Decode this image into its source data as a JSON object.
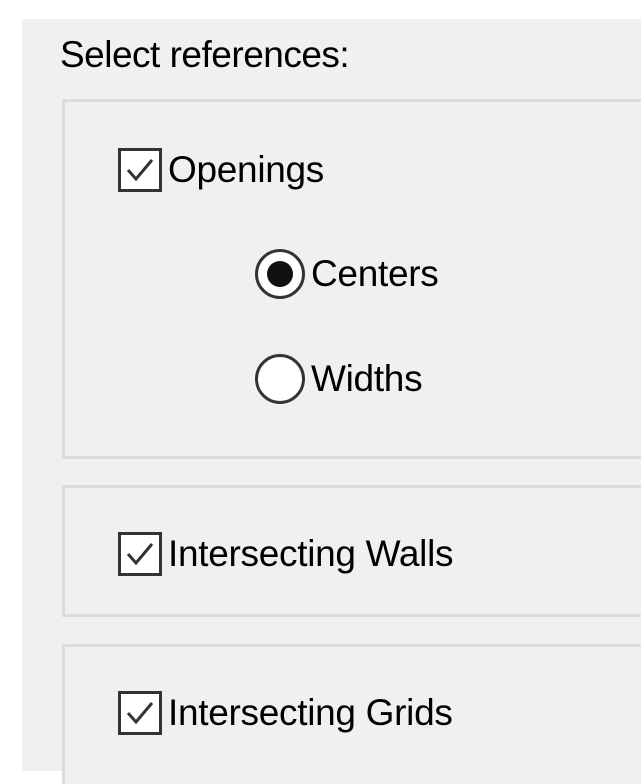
{
  "select_references": {
    "heading": "Select references:",
    "openings": {
      "label": "Openings",
      "checked": true,
      "options": [
        {
          "label": "Centers",
          "selected": true
        },
        {
          "label": "Widths",
          "selected": false
        }
      ]
    },
    "intersecting_walls": {
      "label": "Intersecting Walls",
      "checked": true
    },
    "intersecting_grids": {
      "label": "Intersecting Grids",
      "checked": true
    }
  },
  "colors": {
    "panel_background": "#f0f0f0",
    "control_border": "#333333",
    "group_border": "#dcdcdc",
    "text": "#000000"
  },
  "icons": {
    "checkbox_mark": "checkmark-icon"
  }
}
